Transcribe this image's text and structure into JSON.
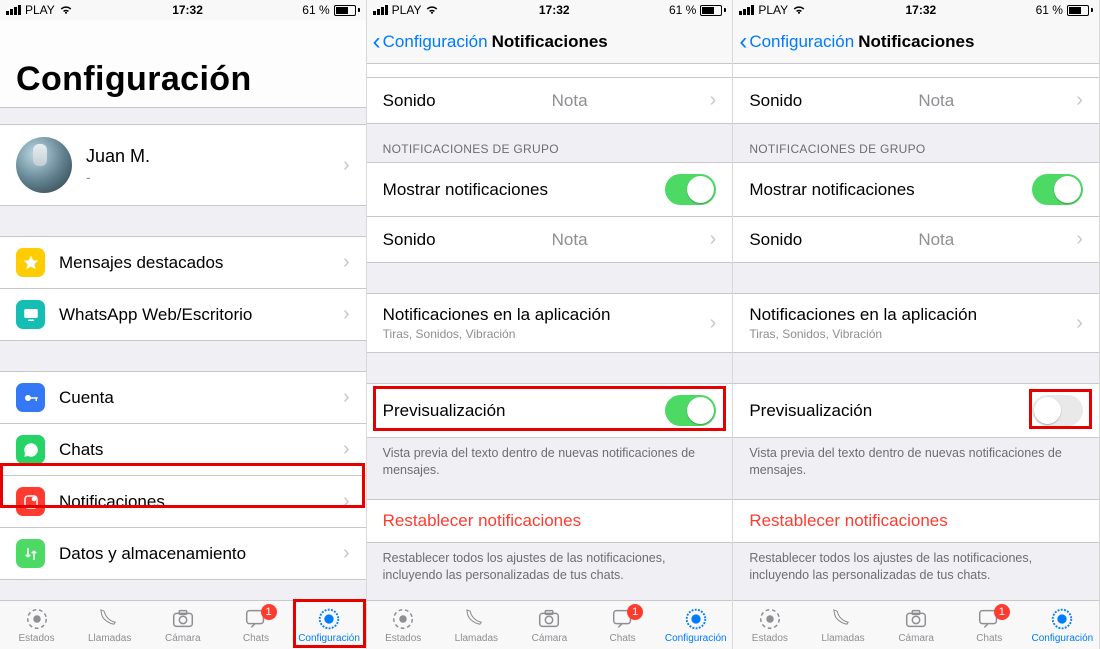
{
  "status": {
    "carrier": "PLAY",
    "time": "17:32",
    "battery_pct": "61 %"
  },
  "screen1": {
    "title": "Configuración",
    "profile": {
      "name": "Juan M.",
      "status": "-"
    },
    "rows": {
      "starred": "Mensajes destacados",
      "web": "WhatsApp Web/Escritorio",
      "account": "Cuenta",
      "chats": "Chats",
      "notifications": "Notificaciones",
      "data": "Datos y almacenamiento"
    }
  },
  "notif": {
    "back_label": "Configuración",
    "title": "Notificaciones",
    "sound_label": "Sonido",
    "sound_value": "Nota",
    "group_header": "NOTIFICACIONES DE GRUPO",
    "show_label": "Mostrar notificaciones",
    "inapp_label": "Notificaciones en la aplicación",
    "inapp_sub": "Tiras, Sonidos, Vibración",
    "preview_label": "Previsualización",
    "preview_footer": "Vista previa del texto dentro de nuevas notificaciones de mensajes.",
    "reset_label": "Restablecer notificaciones",
    "reset_footer": "Restablecer todos los ajustes de las notificaciones, incluyendo las personalizadas de tus chats."
  },
  "tabs": {
    "status": "Estados",
    "calls": "Llamadas",
    "camera": "Cámara",
    "chats": "Chats",
    "chats_badge": "1",
    "settings": "Configuración"
  }
}
